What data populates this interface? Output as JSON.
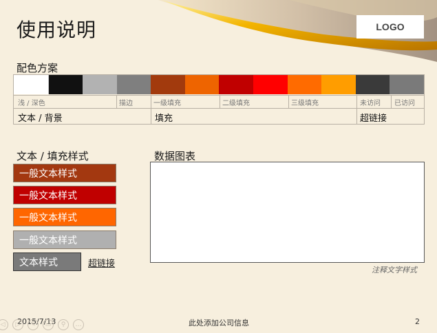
{
  "title": "使用说明",
  "logo": "LOGO",
  "palette": {
    "label": "配色方案",
    "swatch_colors": [
      "#ffffff",
      "#111111",
      "#b2b2b2",
      "#7f7f7f",
      "#a23a0d",
      "#ee6400",
      "#c00000",
      "#ff0000",
      "#ff6b00",
      "#ff9d00",
      "#3a3a3a",
      "#7a7a7a"
    ],
    "small_labels": [
      "浅 / 深色",
      "描边",
      "一级填充",
      "二级填充",
      "三级填充",
      "未访问",
      "已访问"
    ],
    "big_labels": [
      "文本 / 背景",
      "填充",
      "超链接"
    ]
  },
  "styles": {
    "label": "文本 / 填充样式",
    "buttons": [
      {
        "text": "一般文本样式",
        "color": "#a33810"
      },
      {
        "text": "一般文本样式",
        "color": "#c00000"
      },
      {
        "text": "一般文本样式",
        "color": "#ff6600"
      },
      {
        "text": "一般文本样式",
        "color": "#b0b0b0"
      },
      {
        "text": "文本样式",
        "color": "#7a7a7a"
      }
    ],
    "link": "超链接"
  },
  "chart": {
    "label": "数据图表",
    "note": "注释文字样式"
  },
  "footer": {
    "date": "2015/7/13",
    "company": "此处添加公司信息",
    "page": "2"
  },
  "controls": [
    "◁",
    "▷",
    "✎",
    "▭",
    "⚲",
    "…"
  ]
}
